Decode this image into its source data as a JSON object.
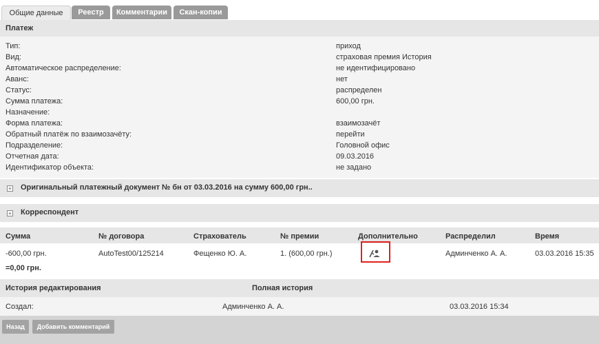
{
  "tabs": [
    "Общие данные",
    "Реестр",
    "Комментарии",
    "Скан-копии"
  ],
  "payment": {
    "header": "Платеж",
    "rows": [
      {
        "label": "Тип:",
        "value": "приход"
      },
      {
        "label": "Вид:",
        "value": "страховая премия История"
      },
      {
        "label": "Автоматическое распределение:",
        "value": "не идентифицировано"
      },
      {
        "label": "Аванс:",
        "value": "нет"
      },
      {
        "label": "Статус:",
        "value": "распределен"
      },
      {
        "label": "Сумма платежа:",
        "value": "600,00 грн."
      },
      {
        "label": "Назначение:",
        "value": ""
      },
      {
        "label": "Форма платежа:",
        "value": "взаимозачёт"
      },
      {
        "label": "Обратный платёж по взаимозачёту:",
        "value": "перейти"
      },
      {
        "label": "Подразделение:",
        "value": "Головной офис"
      },
      {
        "label": "Отчетная дата:",
        "value": "09.03.2016"
      },
      {
        "label": "Идентификатор объекта:",
        "value": "не задано"
      }
    ]
  },
  "original_doc": {
    "label": "Оригинальный платежный документ № бн от 03.03.2016 на сумму 600,00 грн.."
  },
  "correspondent": {
    "label": "Корреспондент"
  },
  "distribution": {
    "headers": [
      "Сумма",
      "№ договора",
      "Страхователь",
      "№ премии",
      "Дополнительно",
      "Распределил",
      "Время"
    ],
    "row": {
      "amount": "-600,00 грн.",
      "contract": "AutoTest00/125214",
      "insurer": "Фещенко Ю. А.",
      "premium": "1. (600,00 грн.)",
      "extra_icon": "user-assign-icon",
      "distributed_by": "Админченко А. А.",
      "time": "03.03.2016 15:35"
    },
    "total": "=0,00 грн."
  },
  "history": {
    "title": "История редактирования",
    "full_link": "Полная история",
    "created_label": "Создал:",
    "created_by": "Админченко А. А.",
    "created_time": "03.03.2016 15:34"
  },
  "buttons": {
    "back": "Назад",
    "add_comment": "Добавить комментарий"
  },
  "colors": {
    "highlight_border": "#e0201e",
    "tab_inactive": "#9a9a9a",
    "header_bg": "#e6e6e6",
    "button_bg": "#a3a3a3"
  }
}
